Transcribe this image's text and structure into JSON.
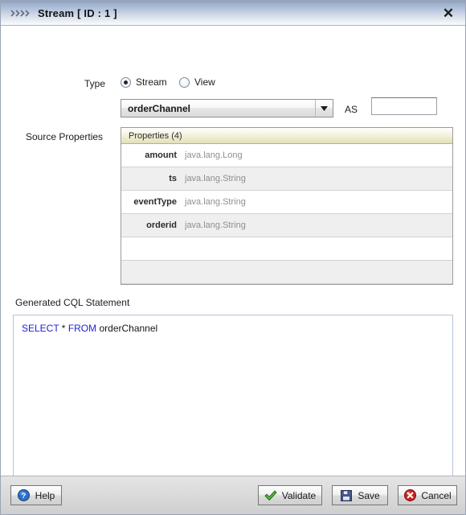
{
  "window": {
    "title": "Stream [ ID : 1 ]",
    "icon": "chevrons-icon",
    "close_icon": "close-icon",
    "close_label": "✕"
  },
  "form": {
    "type_label": "Type",
    "radios": [
      {
        "label": "Stream",
        "checked": true
      },
      {
        "label": "View",
        "checked": false
      }
    ],
    "stream_select": {
      "value": "orderChannel",
      "arrow_icon": "chevron-down-icon"
    },
    "as_label": "AS",
    "as_input": {
      "value": "",
      "placeholder": ""
    },
    "source_properties_label": "Source Properties"
  },
  "properties_table": {
    "header": "Properties (4)",
    "count": 4,
    "columns": [
      "name",
      "type"
    ],
    "rows": [
      {
        "name": "amount",
        "type": "java.lang.Long"
      },
      {
        "name": "ts",
        "type": "java.lang.String"
      },
      {
        "name": "eventType",
        "type": "java.lang.String"
      },
      {
        "name": "orderid",
        "type": "java.lang.String"
      }
    ],
    "empty_rows": 2
  },
  "cql": {
    "label": "Generated CQL Statement",
    "statement": "SELECT * FROM orderChannel",
    "tokens": [
      {
        "text": "SELECT",
        "keyword": true
      },
      {
        "text": " * ",
        "keyword": false
      },
      {
        "text": "FROM",
        "keyword": true
      },
      {
        "text": " orderChannel",
        "keyword": false
      }
    ]
  },
  "footer": {
    "help": {
      "label": "Help",
      "icon": "help-question-icon"
    },
    "validate": {
      "label": "Validate",
      "icon": "green-check-icon"
    },
    "save": {
      "label": "Save",
      "icon": "floppy-disk-icon"
    },
    "cancel": {
      "label": "Cancel",
      "icon": "red-x-circle-icon"
    }
  },
  "colors": {
    "titlebar_blue": "#8ba0c2",
    "keyword_blue": "#1f23d0",
    "header_cream": "#e3e0bc",
    "type_gray": "#8e8e8e",
    "validate_green": "#3a9e25",
    "save_navy": "#3b4a7e",
    "cancel_red": "#cc2020"
  }
}
